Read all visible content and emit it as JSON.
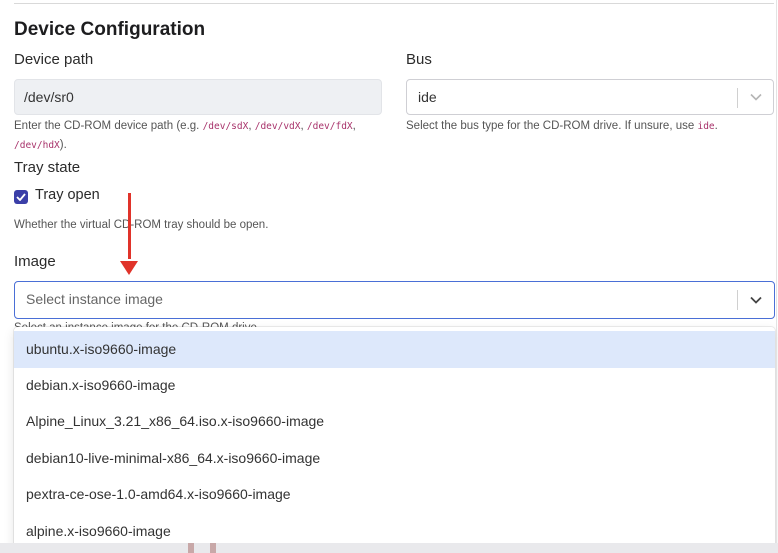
{
  "section_title": "Device Configuration",
  "device_path": {
    "label": "Device path",
    "value": "/dev/sr0",
    "help_prefix": "Enter the CD-ROM device path (e.g. ",
    "examples": [
      "/dev/sdX",
      "/dev/vdX",
      "/dev/fdX",
      "/dev/hdX"
    ],
    "help_suffix": ")."
  },
  "bus": {
    "label": "Bus",
    "value": "ide",
    "help_prefix": "Select the bus type for the CD-ROM drive. If unsure, use ",
    "help_code": "ide",
    "help_suffix": "."
  },
  "tray": {
    "label": "Tray state",
    "checkbox_label": "Tray open",
    "checked": true,
    "help": "Whether the virtual CD-ROM tray should be open."
  },
  "image": {
    "label": "Image",
    "placeholder": "Select instance image",
    "help_partial": "Select an instance image for the CD-ROM drive.",
    "options": [
      "ubuntu.x-iso9660-image",
      "debian.x-iso9660-image",
      "Alpine_Linux_3.21_x86_64.iso.x-iso9660-image",
      "debian10-live-minimal-x86_64.x-iso9660-image",
      "pextra-ce-ose-1.0-amd64.x-iso9660-image",
      "alpine.x-iso9660-image"
    ],
    "highlighted_index": 0
  },
  "colors": {
    "accent": "#4a6fd6",
    "checkbox": "#3b3fa8",
    "annotation_arrow": "#e0332a",
    "highlight": "#dde8fb"
  },
  "icons": [
    "chevron-down-icon",
    "checkmark-icon",
    "annotation-arrow-icon"
  ]
}
